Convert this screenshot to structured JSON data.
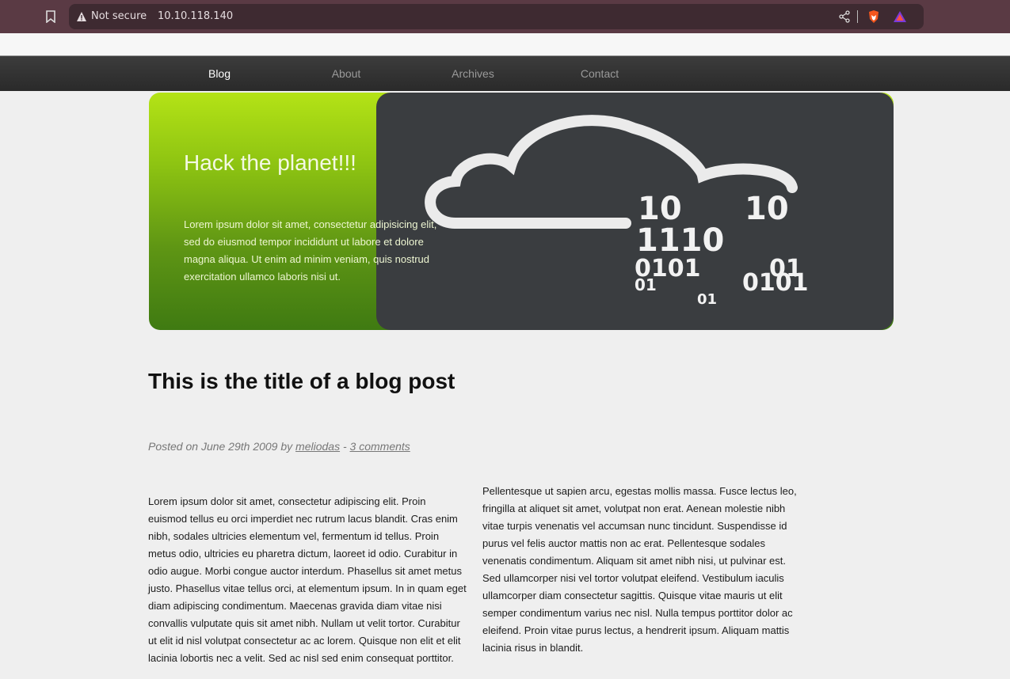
{
  "browser": {
    "security_label": "Not secure",
    "url": "10.10.118.140"
  },
  "nav": {
    "items": [
      {
        "label": "Blog",
        "active": true
      },
      {
        "label": "About",
        "active": false
      },
      {
        "label": "Archives",
        "active": false
      },
      {
        "label": "Contact",
        "active": false
      }
    ]
  },
  "hero": {
    "title": "Hack the planet!!!",
    "text": "Lorem ipsum dolor sit amet, consectetur adipisicing elit, sed do eiusmod tempor incididunt ut labore et dolore magna aliqua. Ut enim ad minim veniam, quis nostrud exercitation ullamco laboris nisi ut.",
    "image_binary": [
      "10",
      "10",
      "1110",
      "0101",
      "01",
      "01",
      "0101",
      "01"
    ]
  },
  "post": {
    "title": "This is the title of a blog post",
    "meta_prefix": "Posted on June 29th 2009 by",
    "author": "meliodas",
    "meta_sep": "-",
    "comments": "3 comments",
    "col_left": "Lorem ipsum dolor sit amet, consectetur adipiscing elit. Proin euismod tellus eu orci imperdiet nec rutrum lacus blandit. Cras enim nibh, sodales ultricies elementum vel, fermentum id tellus. Proin metus odio, ultricies eu pharetra dictum, laoreet id odio. Curabitur in odio augue. Morbi congue auctor interdum. Phasellus sit amet metus justo. Phasellus vitae tellus orci, at elementum ipsum. In in quam eget diam adipiscing condimentum. Maecenas gravida diam vitae nisi convallis vulputate quis sit amet nibh. Nullam ut velit tortor. Curabitur ut elit id nisl volutpat consectetur ac ac lorem. Quisque non elit et elit lacinia lobortis nec a velit. Sed ac nisl sed enim consequat porttitor.",
    "col_right": "Pellentesque ut sapien arcu, egestas mollis massa. Fusce lectus leo, fringilla at aliquet sit amet, volutpat non erat. Aenean molestie nibh vitae turpis venenatis vel accumsan nunc tincidunt. Suspendisse id purus vel felis auctor mattis non ac erat. Pellentesque sodales venenatis condimentum. Aliquam sit amet nibh nisi, ut pulvinar est. Sed ullamcorper nisi vel tortor volutpat eleifend. Vestibulum iaculis ullamcorper diam consectetur sagittis. Quisque vitae mauris ut elit semper condimentum varius nec nisl. Nulla tempus porttitor dolor ac eleifend. Proin vitae purus lectus, a hendrerit ipsum. Aliquam mattis lacinia risus in blandit."
  }
}
